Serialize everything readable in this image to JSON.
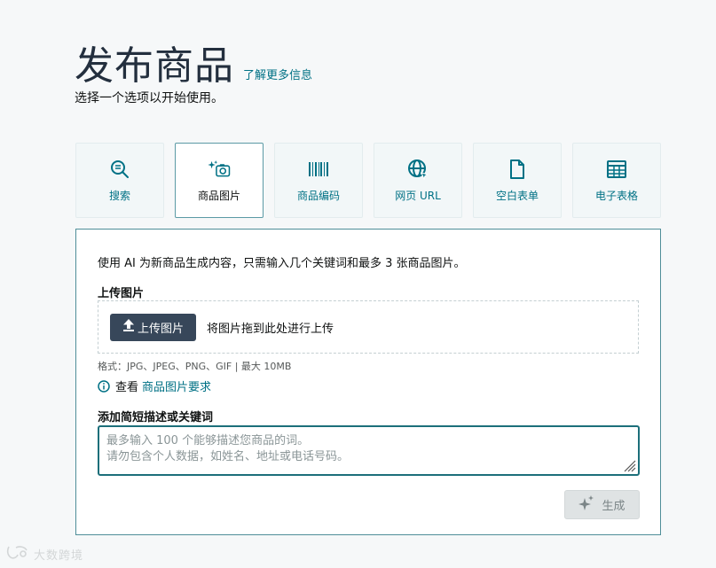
{
  "header": {
    "title": "发布商品",
    "learn_more": "了解更多信息",
    "subtitle": "选择一个选项以开始使用。"
  },
  "options": [
    {
      "label": "搜索",
      "icon": "search-icon",
      "selected": false
    },
    {
      "label": "商品图片",
      "icon": "sparkle-camera-icon",
      "selected": true
    },
    {
      "label": "商品编码",
      "icon": "barcode-icon",
      "selected": false
    },
    {
      "label": "网页 URL",
      "icon": "globe-icon",
      "selected": false
    },
    {
      "label": "空白表单",
      "icon": "document-icon",
      "selected": false
    },
    {
      "label": "电子表格",
      "icon": "spreadsheet-icon",
      "selected": false
    }
  ],
  "panel": {
    "intro": "使用 AI 为新商品生成内容，只需输入几个关键词和最多 3 张商品图片。",
    "upload_label": "上传图片",
    "upload_button": "上传图片",
    "drop_hint": "将图片拖到此处进行上传",
    "formats": "格式：JPG、JPEG、PNG、GIF | 最大 10MB",
    "view_prefix": "查看",
    "requirements_link": "商品图片要求",
    "desc_label": "添加简短描述或关键词",
    "desc_placeholder": "最多输入 100 个能够描述您商品的词。\n请勿包含个人数据，如姓名、地址或电话号码。",
    "generate_button": "生成"
  },
  "watermark": {
    "text": "大数跨境"
  },
  "colors": {
    "accent": "#007185",
    "panel_border": "#4f8e99",
    "upload_button_bg": "#37475a"
  }
}
